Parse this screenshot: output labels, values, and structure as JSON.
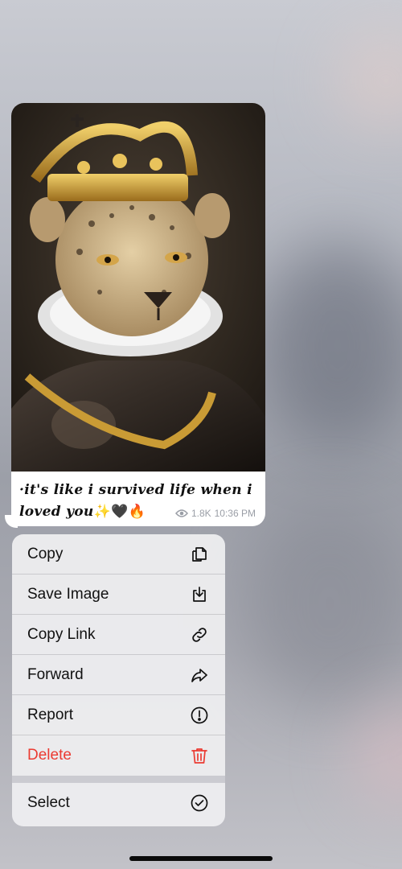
{
  "message": {
    "caption_line1": "·it's like i survived life when i",
    "caption_line2": "loved you",
    "caption_emojis": "✨🖤🔥",
    "views": "1.8K",
    "time": "10:36 PM"
  },
  "menu": {
    "items": [
      {
        "label": "Copy",
        "icon": "copy-icon"
      },
      {
        "label": "Save Image",
        "icon": "save-image-icon"
      },
      {
        "label": "Copy Link",
        "icon": "link-icon"
      },
      {
        "label": "Forward",
        "icon": "forward-icon"
      },
      {
        "label": "Report",
        "icon": "report-icon"
      },
      {
        "label": "Delete",
        "icon": "trash-icon",
        "color": "#eb3b32"
      }
    ],
    "select": {
      "label": "Select",
      "icon": "checkmark-circle-icon"
    }
  }
}
